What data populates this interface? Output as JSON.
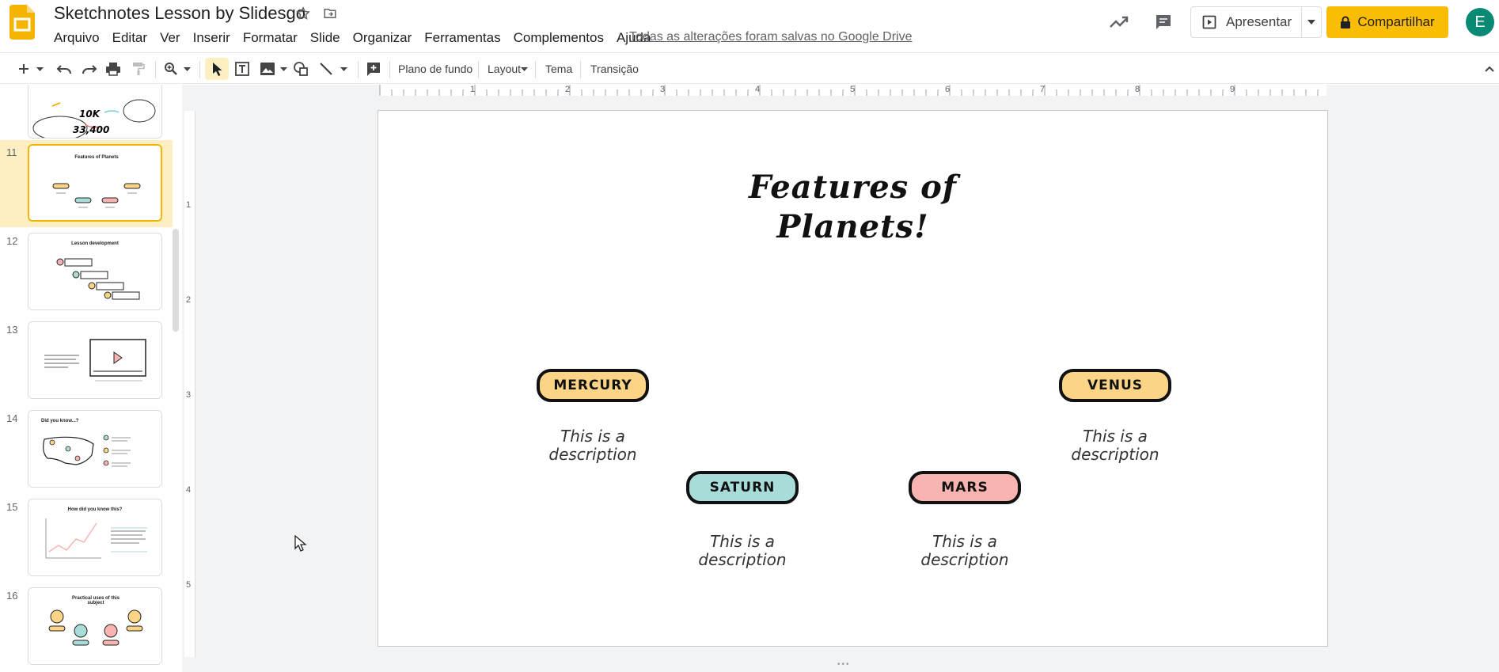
{
  "header": {
    "doc_title": "Sketchnotes Lesson by Slidesgo",
    "menu": [
      "Arquivo",
      "Editar",
      "Ver",
      "Inserir",
      "Formatar",
      "Slide",
      "Organizar",
      "Ferramentas",
      "Complementos",
      "Ajuda"
    ],
    "saved_note": "Todas as alterações foram salvas no Google Drive",
    "present_label": "Apresentar",
    "share_label": "Compartilhar",
    "avatar_letter": "E",
    "accent_color": "#fbbc04",
    "avatar_color": "#0a8a74"
  },
  "toolbar": {
    "background_label": "Plano de fundo",
    "layout_label": "Layout",
    "theme_label": "Tema",
    "transition_label": "Transição"
  },
  "filmstrip": {
    "thumb10_numbers": [
      "10K",
      "33,400"
    ],
    "slides": [
      {
        "number": "11",
        "title": "Features of Planets"
      },
      {
        "number": "12",
        "title": "Lesson development"
      },
      {
        "number": "13",
        "title": ""
      },
      {
        "number": "14",
        "title": "Did you know...?"
      },
      {
        "number": "15",
        "title": "How did you know this?"
      },
      {
        "number": "16",
        "title": "Practical uses of this subject"
      }
    ]
  },
  "ruler": {
    "top_numbers": [
      "1",
      "2",
      "3",
      "4",
      "5",
      "6",
      "7",
      "8",
      "9"
    ],
    "left_numbers": [
      "1",
      "2",
      "3",
      "4",
      "5"
    ]
  },
  "slide": {
    "title_line1": "Features of",
    "title_line2": "Planets!",
    "planets": [
      {
        "name": "MERCURY",
        "color": "#fcd486",
        "description_line1": "This is a",
        "description_line2": "description"
      },
      {
        "name": "VENUS",
        "color": "#fcd486",
        "description_line1": "This is a",
        "description_line2": "description"
      },
      {
        "name": "SATURN",
        "color": "#a8dcd9",
        "description_line1": "This is a",
        "description_line2": "description"
      },
      {
        "name": "MARS",
        "color": "#f8b4b0",
        "description_line1": "This is a",
        "description_line2": "description"
      }
    ]
  }
}
